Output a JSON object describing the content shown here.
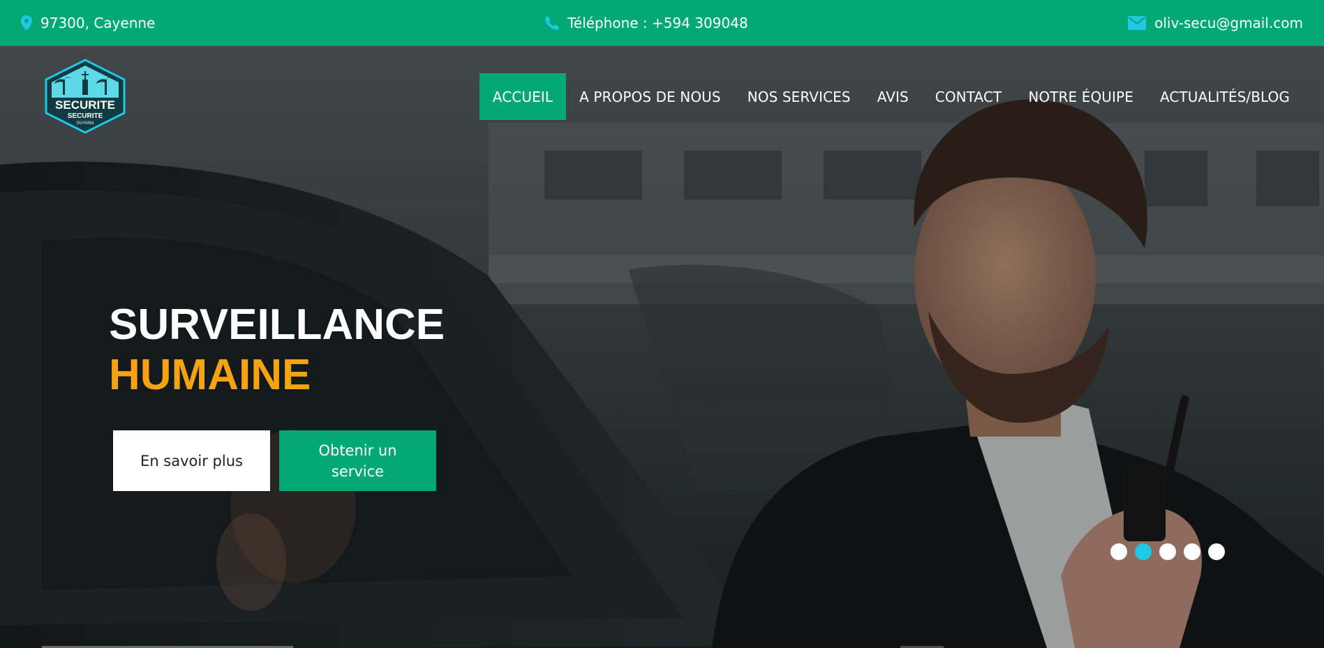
{
  "topbar": {
    "address": "97300, Cayenne",
    "phone": "Téléphone : +594 309048",
    "email": "oliv-secu@gmail.com",
    "icon_color": "#1fc8e6",
    "icons": [
      "map-pin-icon",
      "phone-icon",
      "envelope-icon"
    ]
  },
  "logo": {
    "text_main": "SECURITE",
    "text_sub": "SECURITE",
    "text_small": "GUYANA"
  },
  "nav": {
    "items": [
      {
        "label": "ACCUEIL",
        "active": true
      },
      {
        "label": "A PROPOS DE NOUS",
        "active": false
      },
      {
        "label": "NOS SERVICES",
        "active": false
      },
      {
        "label": "AVIS",
        "active": false
      },
      {
        "label": "CONTACT",
        "active": false
      },
      {
        "label": "NOTRE ÉQUIPE",
        "active": false
      },
      {
        "label": "ACTUALITÉS/BLOG",
        "active": false
      }
    ]
  },
  "hero": {
    "title_line1": "SURVEILLANCE",
    "title_line2": "HUMAINE",
    "btn_more": "En savoir plus",
    "btn_service": "Obtenir un service",
    "slides": 5,
    "active_slide": 2
  },
  "colors": {
    "brand_green": "#03a874",
    "accent_orange": "#f6a313",
    "accent_cyan": "#1fc8e6"
  }
}
